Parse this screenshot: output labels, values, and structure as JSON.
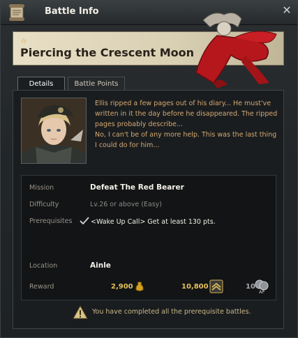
{
  "window": {
    "title": "Battle Info",
    "close_icon": "close-icon"
  },
  "banner": {
    "title": "Piercing the Crescent Moon",
    "star_icon": "star-icon"
  },
  "tabs": [
    {
      "label": "Details",
      "active": true
    },
    {
      "label": "Battle Points",
      "active": false
    }
  ],
  "story": {
    "paragraph1": "Ellis ripped a few pages out of his diary... He must've written in it the day before he disappeared. The ripped pages probably describe...",
    "paragraph2": "No, I can't be of any more help. This was the last thing I could do for him..."
  },
  "info": {
    "mission_label": "Mission",
    "mission_value": "Defeat The Red Bearer",
    "difficulty_label": "Difficulty",
    "difficulty_value": "Lv.26 or above (Easy)",
    "prerequisites_label": "Prerequisites",
    "prerequisites_value": "<Wake Up Call> Get at least 130 pts.",
    "location_label": "Location",
    "location_value": "Ainle",
    "reward_label": "Reward",
    "reward_gold": "2,900",
    "reward_exp": "10,800",
    "reward_ap": "10",
    "ap_icon_text": "AP"
  },
  "warning": {
    "text": "You have completed all the prerequisite battles."
  },
  "colors": {
    "accent_gold": "#e6c15a",
    "story_text": "#d4a873"
  }
}
